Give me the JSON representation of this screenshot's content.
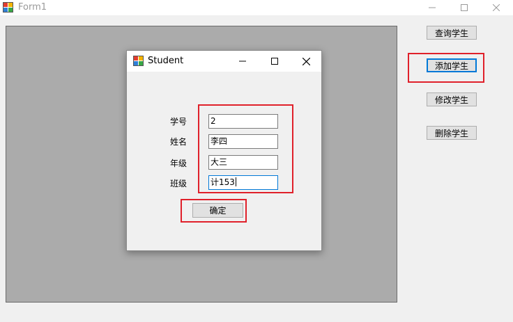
{
  "main_window": {
    "title": "Form1",
    "icon": "winforms-app-icon",
    "controls": {
      "minimize": "minimize-icon",
      "maximize": "maximize-icon",
      "close": "close-icon"
    }
  },
  "sidebar": {
    "query_label": "查询学生",
    "add_label": "添加学生",
    "edit_label": "修改学生",
    "delete_label": "删除学生"
  },
  "dialog": {
    "title": "Student",
    "icon": "winforms-app-icon",
    "fields": [
      {
        "label": "学号",
        "value": "2"
      },
      {
        "label": "姓名",
        "value": "李四"
      },
      {
        "label": "年级",
        "value": "大三"
      },
      {
        "label": "班级",
        "value": "计153"
      }
    ],
    "ok_label": "确定"
  },
  "colors": {
    "highlight_box": "#e0202a",
    "mdi_background": "#ababab",
    "focus_border": "#0078d7"
  }
}
